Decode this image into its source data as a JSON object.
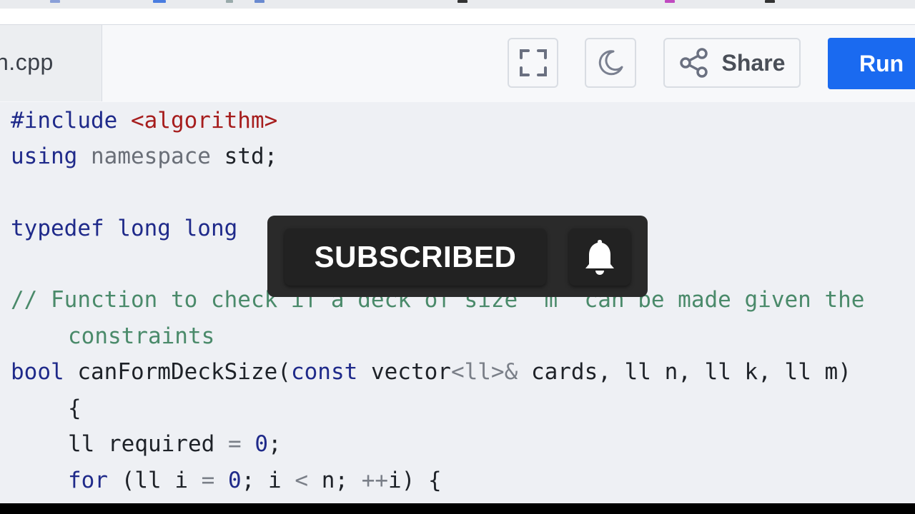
{
  "header": {
    "file_name": "n.cpp",
    "share_label": "Share",
    "run_label": "Run"
  },
  "icons": {
    "fullscreen": "fullscreen-icon",
    "theme": "moon-icon",
    "share": "share-icon",
    "bell": "bell-icon"
  },
  "code": {
    "line1_pp": "#include",
    "line1_inc": "<algorithm>",
    "line2_kw": "using",
    "line2_ns": "namespace",
    "line2_rest": "std;",
    "line3_kw": "typedef long long",
    "line4_comment": "// Function to check if a deck of size `m` can be made given the",
    "line5_comment": "constraints",
    "line6_kw1": "bool",
    "line6_fn": "canFormDeckSize(",
    "line6_kw2": "const",
    "line6_type": "vector",
    "line6_tpl": "<ll>",
    "line6_amp": "&",
    "line6_rest": "cards, ll n, ll k, ll m)",
    "line7": "{",
    "line8_a": "ll required",
    "line8_op": "=",
    "line8_num": "0",
    "line8_end": ";",
    "line9_kw": "for",
    "line9_a": "(ll i",
    "line9_op1": "=",
    "line9_num": "0",
    "line9_b": "; i",
    "line9_op2": "<",
    "line9_c": "n;",
    "line9_op3": "++",
    "line9_d": "i) {"
  },
  "overlay": {
    "subscribed_label": "SUBSCRIBED"
  },
  "colors": {
    "run_button": "#1a6af0",
    "keyword": "#1f2a8a",
    "include_target": "#a61d1d",
    "comment": "#4a8a6a"
  }
}
